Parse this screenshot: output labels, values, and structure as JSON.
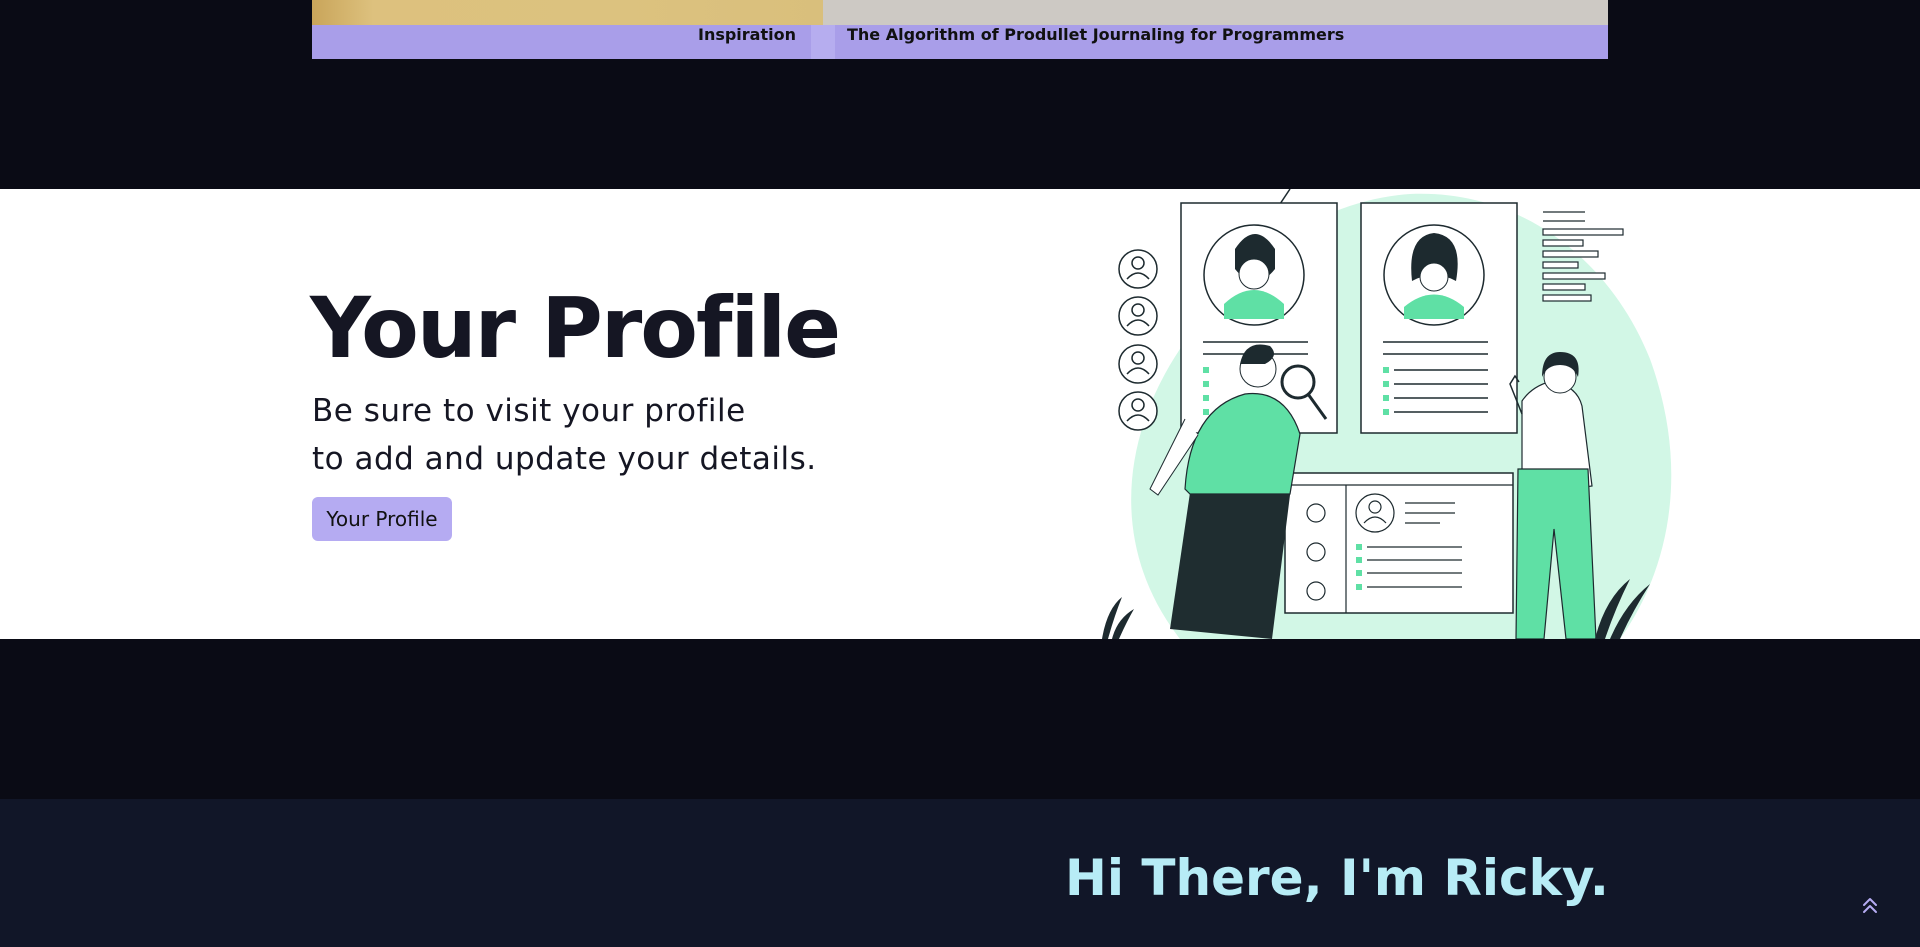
{
  "featured_post": {
    "category": "Inspiration",
    "title": "The Algorithm of Produllet Journaling for Programmers"
  },
  "profile_section": {
    "title": "Your Profile",
    "subtitle_line1": "Be sure to visit your profile",
    "subtitle_line2": "to add and update your details.",
    "button_label": "Your Profile"
  },
  "intro_section": {
    "heading": "Hi There, I'm Ricky."
  },
  "icons": {
    "scroll_top": "double-chevron-up-icon"
  },
  "colors": {
    "page_bg": "#0a0b15",
    "accent_lavender": "#a99ee9",
    "button_bg": "#b5abf2",
    "illustration_green": "#5fe0a5",
    "illustration_blob": "#d2f7e6",
    "intro_bg": "#111628",
    "intro_heading": "#b7ecf6"
  }
}
